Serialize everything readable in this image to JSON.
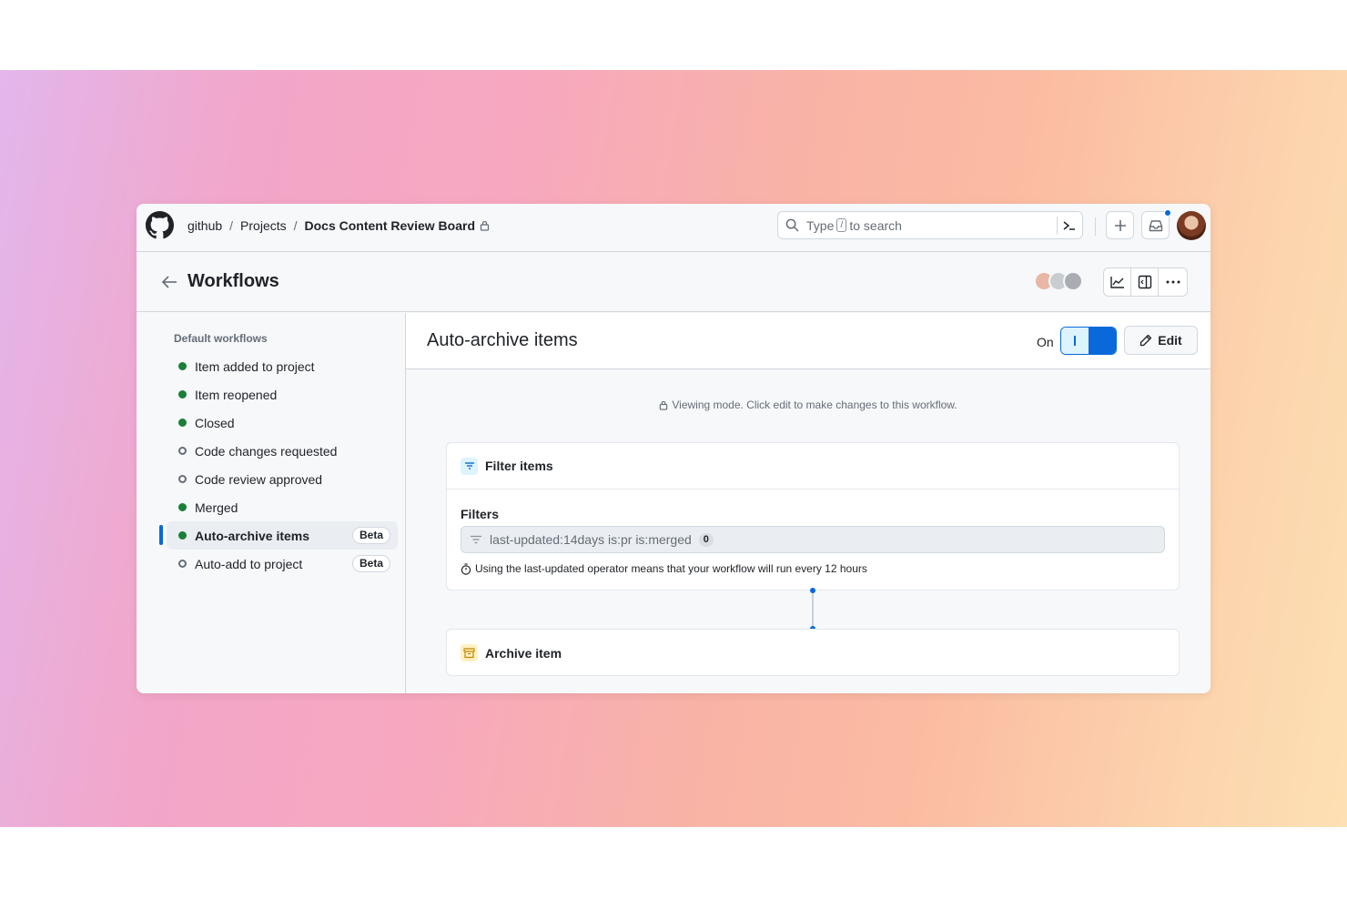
{
  "colors": {
    "accent": "#0969da",
    "success": "#1a7f37",
    "border": "#d0d7de",
    "muted": "#656d76"
  },
  "topbar": {
    "breadcrumbs": [
      {
        "label": "github"
      },
      {
        "label": "Projects"
      },
      {
        "label": "Docs Content Review Board"
      }
    ],
    "search": {
      "prefix": "Type",
      "key": "/",
      "suffix": "to search"
    },
    "icons": [
      "github-logo-icon",
      "lock-icon",
      "search-icon",
      "command-palette-icon",
      "plus-icon",
      "inbox-icon",
      "avatar"
    ]
  },
  "header": {
    "title": "Workflows",
    "icons": [
      "back-arrow-icon",
      "insights-icon",
      "panel-icon",
      "kebab-icon"
    ]
  },
  "sidebar": {
    "heading": "Default workflows",
    "items": [
      {
        "label": "Item added to project",
        "enabled": true,
        "badge": ""
      },
      {
        "label": "Item reopened",
        "enabled": true,
        "badge": ""
      },
      {
        "label": "Closed",
        "enabled": true,
        "badge": ""
      },
      {
        "label": "Code changes requested",
        "enabled": false,
        "badge": ""
      },
      {
        "label": "Code review approved",
        "enabled": false,
        "badge": ""
      },
      {
        "label": "Merged",
        "enabled": true,
        "badge": ""
      },
      {
        "label": "Auto-archive items",
        "enabled": true,
        "badge": "Beta",
        "selected": true
      },
      {
        "label": "Auto-add to project",
        "enabled": false,
        "badge": "Beta"
      }
    ]
  },
  "main": {
    "title": "Auto-archive items",
    "toggle_label": "On",
    "toggle_on": true,
    "edit_label": "Edit",
    "viewing_note": "Viewing mode. Click edit to make changes to this workflow.",
    "filter_card": {
      "title": "Filter items",
      "filters_label": "Filters",
      "filter_value": "last-updated:14days is:pr is:merged",
      "filter_count": "0",
      "note": "Using the last-updated operator means that your workflow will run every 12 hours"
    },
    "archive_card": {
      "title": "Archive item"
    }
  }
}
